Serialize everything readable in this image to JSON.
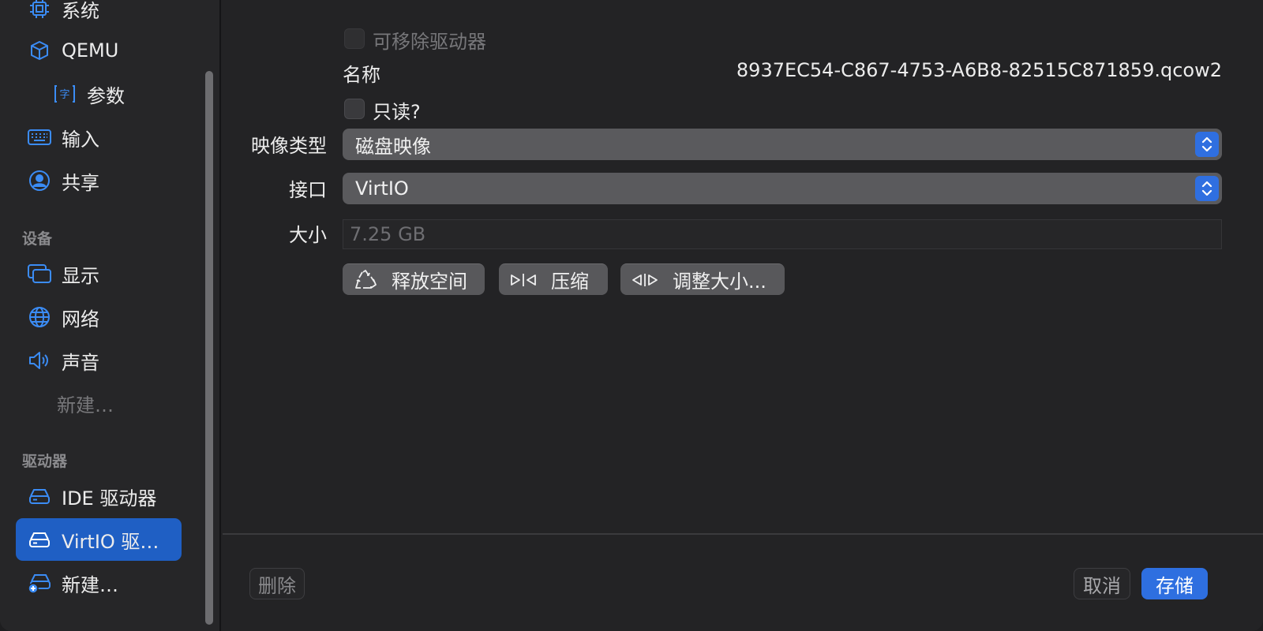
{
  "sidebar": {
    "items": [
      {
        "label": "系统",
        "icon": "cpu-icon"
      },
      {
        "label": "QEMU",
        "icon": "cube-icon"
      },
      {
        "label": "参数",
        "icon": "text-format-icon"
      },
      {
        "label": "输入",
        "icon": "keyboard-icon"
      },
      {
        "label": "共享",
        "icon": "person-circle-icon"
      }
    ],
    "devices_section": "设备",
    "devices": [
      {
        "label": "显示",
        "icon": "display-icon"
      },
      {
        "label": "网络",
        "icon": "globe-icon"
      },
      {
        "label": "声音",
        "icon": "speaker-icon"
      },
      {
        "label": "新建…"
      }
    ],
    "drives_section": "驱动器",
    "drives": [
      {
        "label": "IDE 驱动器",
        "icon": "drive-icon"
      },
      {
        "label": "VirtIO 驱…",
        "icon": "drive-icon"
      },
      {
        "label": "新建…",
        "icon": "drive-add-icon"
      }
    ]
  },
  "main": {
    "removable_label": "可移除驱动器",
    "name_label": "名称",
    "name_value": "8937EC54-C867-4753-A6B8-82515C871859.qcow2",
    "readonly_label": "只读?",
    "image_type_label": "映像类型",
    "image_type_value": "磁盘映像",
    "interface_label": "接口",
    "interface_value": "VirtIO",
    "size_label": "大小",
    "size_value": "7.25 GB",
    "buttons": {
      "reclaim": "释放空间",
      "compress": "压缩",
      "resize": "调整大小..."
    }
  },
  "footer": {
    "delete": "删除",
    "cancel": "取消",
    "save": "存储"
  },
  "colors": {
    "accent": "#2e6fe0",
    "selection": "#1f5fc4",
    "icon_blue": "#3b8cf5"
  }
}
